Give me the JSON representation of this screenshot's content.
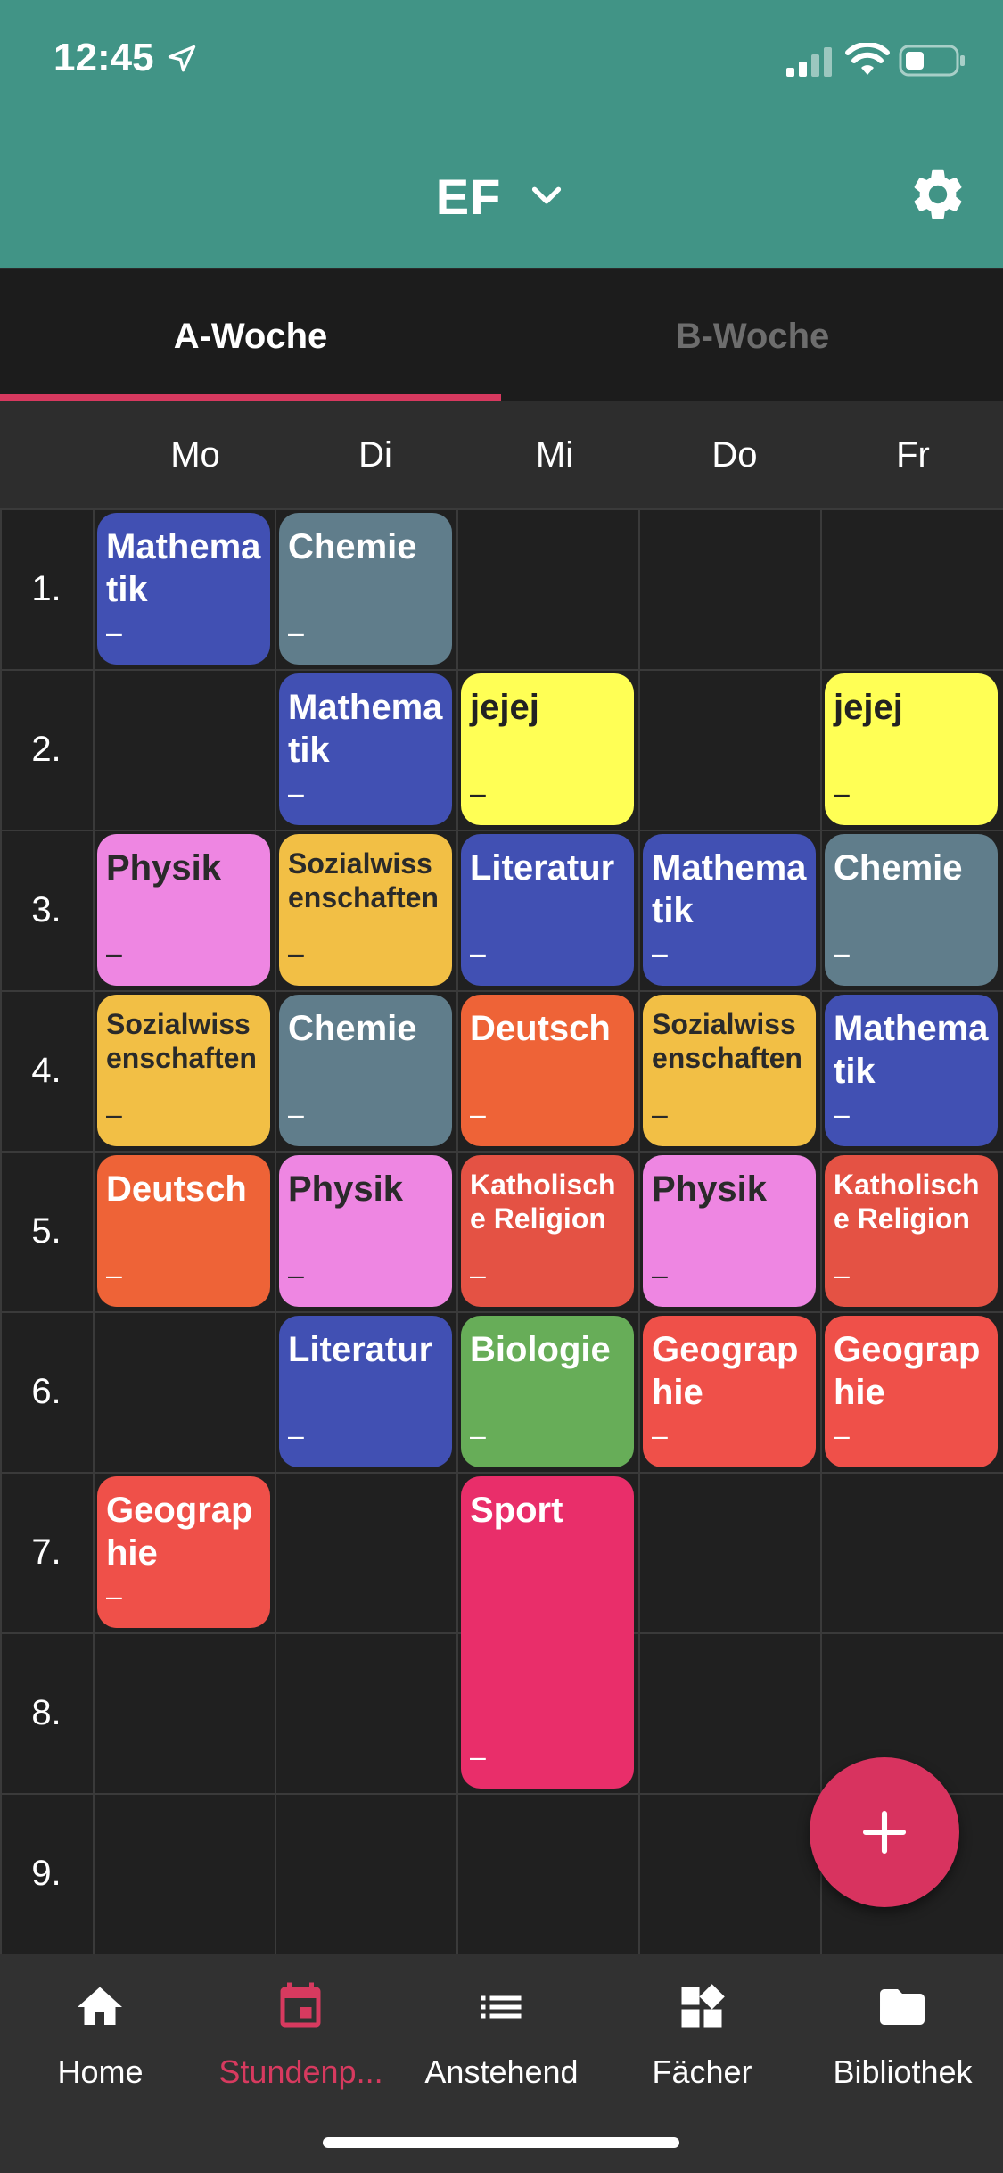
{
  "status_bar": {
    "time": "12:45"
  },
  "header": {
    "title": "EF"
  },
  "tabs": [
    {
      "label": "A-Woche",
      "active": true
    },
    {
      "label": "B-Woche",
      "active": false
    }
  ],
  "days": [
    "Mo",
    "Di",
    "Mi",
    "Do",
    "Fr"
  ],
  "periods": [
    "1.",
    "2.",
    "3.",
    "4.",
    "5.",
    "6.",
    "7.",
    "8.",
    "9."
  ],
  "lessons": [
    {
      "name": "Mathematik",
      "room": "–",
      "day": 0,
      "period": 1,
      "color": "#4150b3",
      "text_color": "#ffffff"
    },
    {
      "name": "Chemie",
      "room": "–",
      "day": 1,
      "period": 1,
      "color": "#607d8b",
      "text_color": "#ffffff"
    },
    {
      "name": "Mathematik",
      "room": "–",
      "day": 1,
      "period": 2,
      "color": "#4150b3",
      "text_color": "#ffffff"
    },
    {
      "name": "jejej",
      "room": "–",
      "day": 2,
      "period": 2,
      "color": "#ffff55",
      "text_color": "#222222"
    },
    {
      "name": "jejej",
      "room": "–",
      "day": 4,
      "period": 2,
      "color": "#ffff55",
      "text_color": "#222222"
    },
    {
      "name": "Physik",
      "room": "–",
      "day": 0,
      "period": 3,
      "color": "#ee86e2",
      "text_color": "#2a2a2a"
    },
    {
      "name": "Sozialwissenschaften",
      "room": "–",
      "day": 1,
      "period": 3,
      "color": "#f2bf45",
      "text_color": "#2a2a2a"
    },
    {
      "name": "Literatur",
      "room": "–",
      "day": 2,
      "period": 3,
      "color": "#4150b3",
      "text_color": "#ffffff"
    },
    {
      "name": "Mathematik",
      "room": "–",
      "day": 3,
      "period": 3,
      "color": "#4150b3",
      "text_color": "#ffffff"
    },
    {
      "name": "Chemie",
      "room": "–",
      "day": 4,
      "period": 3,
      "color": "#607d8b",
      "text_color": "#ffffff"
    },
    {
      "name": "Sozialwissenschaften",
      "room": "–",
      "day": 0,
      "period": 4,
      "color": "#f2bf45",
      "text_color": "#2a2a2a"
    },
    {
      "name": "Chemie",
      "room": "–",
      "day": 1,
      "period": 4,
      "color": "#607d8b",
      "text_color": "#ffffff"
    },
    {
      "name": "Deutsch",
      "room": "–",
      "day": 2,
      "period": 4,
      "color": "#ee6337",
      "text_color": "#ffffff"
    },
    {
      "name": "Sozialwissenschaften",
      "room": "–",
      "day": 3,
      "period": 4,
      "color": "#f2bf45",
      "text_color": "#2a2a2a"
    },
    {
      "name": "Mathematik",
      "room": "–",
      "day": 4,
      "period": 4,
      "color": "#4150b3",
      "text_color": "#ffffff"
    },
    {
      "name": "Deutsch",
      "room": "–",
      "day": 0,
      "period": 5,
      "color": "#ee6337",
      "text_color": "#ffffff"
    },
    {
      "name": "Physik",
      "room": "–",
      "day": 1,
      "period": 5,
      "color": "#ee86e2",
      "text_color": "#2a2a2a"
    },
    {
      "name": "Katholische Religion",
      "room": "–",
      "day": 2,
      "period": 5,
      "color": "#e45244",
      "text_color": "#ffffff"
    },
    {
      "name": "Physik",
      "room": "–",
      "day": 3,
      "period": 5,
      "color": "#ee86e2",
      "text_color": "#2a2a2a"
    },
    {
      "name": "Katholische Religion",
      "room": "–",
      "day": 4,
      "period": 5,
      "color": "#e45244",
      "text_color": "#ffffff"
    },
    {
      "name": "Literatur",
      "room": "–",
      "day": 1,
      "period": 6,
      "color": "#4150b3",
      "text_color": "#ffffff"
    },
    {
      "name": "Biologie",
      "room": "–",
      "day": 2,
      "period": 6,
      "color": "#67ad58",
      "text_color": "#ffffff"
    },
    {
      "name": "Geographie",
      "room": "–",
      "day": 3,
      "period": 6,
      "color": "#ef5049",
      "text_color": "#ffffff"
    },
    {
      "name": "Geographie",
      "room": "–",
      "day": 4,
      "period": 6,
      "color": "#ef5049",
      "text_color": "#ffffff"
    },
    {
      "name": "Geographie",
      "room": "–",
      "day": 0,
      "period": 7,
      "color": "#ef5049",
      "text_color": "#ffffff"
    },
    {
      "name": "Sport",
      "room": "–",
      "day": 2,
      "period": 7,
      "span": 2,
      "color": "#e92e6a",
      "text_color": "#ffffff"
    }
  ],
  "fab": {
    "icon": "plus-icon"
  },
  "bottom_nav": [
    {
      "label": "Home",
      "icon": "home-icon",
      "active": false
    },
    {
      "label": "Stundenp...",
      "icon": "calendar-icon",
      "active": true
    },
    {
      "label": "Anstehend",
      "icon": "list-icon",
      "active": false
    },
    {
      "label": "Fächer",
      "icon": "widgets-icon",
      "active": false
    },
    {
      "label": "Bibliothek",
      "icon": "folder-icon",
      "active": false
    }
  ],
  "colors": {
    "header": "#419486",
    "accent": "#d8335f",
    "background": "#202020"
  }
}
